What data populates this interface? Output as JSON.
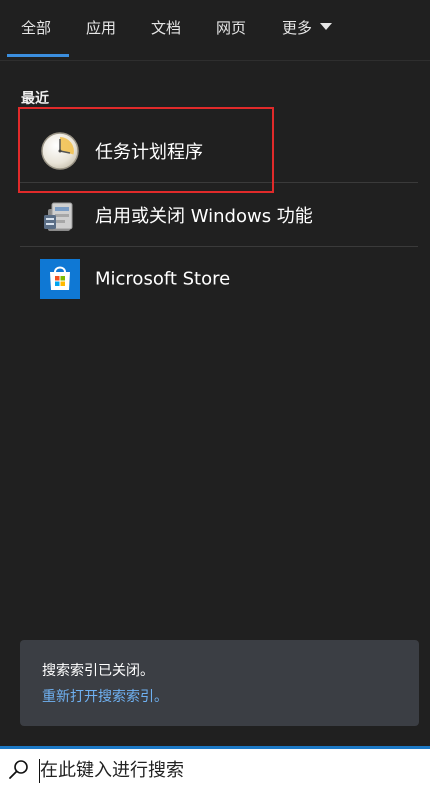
{
  "tabs": [
    {
      "label": "全部",
      "active": true
    },
    {
      "label": "应用",
      "active": false
    },
    {
      "label": "文档",
      "active": false
    },
    {
      "label": "网页",
      "active": false
    },
    {
      "label": "更多",
      "active": false,
      "has_dropdown": true
    }
  ],
  "recent": {
    "title": "最近",
    "items": [
      {
        "label": "任务计划程序",
        "icon": "task-scheduler-clock-icon",
        "highlighted": true
      },
      {
        "label": "启用或关闭 Windows 功能",
        "icon": "windows-features-icon",
        "highlighted": false
      },
      {
        "label": "Microsoft Store",
        "icon": "microsoft-store-icon",
        "highlighted": false
      }
    ]
  },
  "notice": {
    "text": "搜索索引已关闭。",
    "link": "重新打开搜索索引。"
  },
  "search": {
    "placeholder": "在此键入进行搜索",
    "value": ""
  },
  "colors": {
    "panel_bg": "#202020",
    "accent": "#3b8ede",
    "highlight_box": "#e02a2a",
    "notice_bg": "#3b3e44",
    "link": "#6fb1f2",
    "searchbar_border": "#1c79c6"
  }
}
